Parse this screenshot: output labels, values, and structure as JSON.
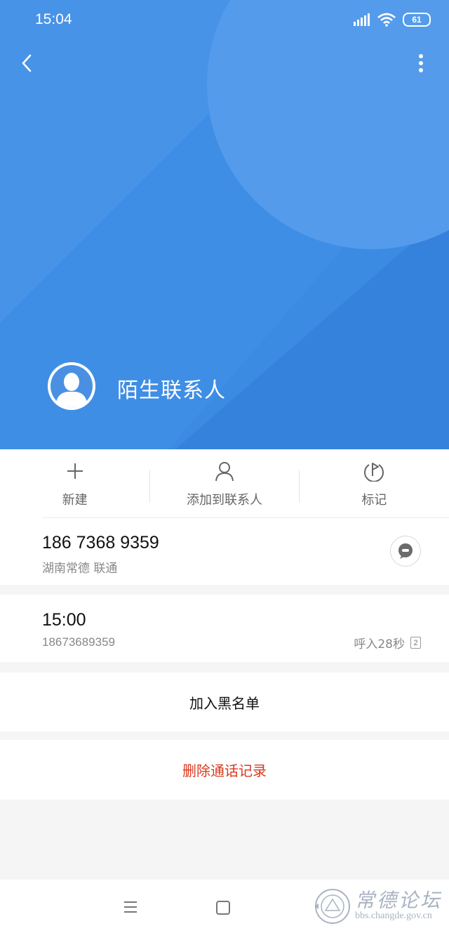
{
  "status_bar": {
    "time": "15:04",
    "battery": "61"
  },
  "contact": {
    "name": "陌生联系人"
  },
  "actions": [
    {
      "label": "新建",
      "icon": "plus-icon"
    },
    {
      "label": "添加到联系人",
      "icon": "person-icon"
    },
    {
      "label": "标记",
      "icon": "flag-icon"
    }
  ],
  "phone": {
    "number": "186 7368 9359",
    "location": "湖南常德 联通"
  },
  "call_record": {
    "time": "15:00",
    "number": "18673689359",
    "info": "呼入28秒",
    "sim": "2"
  },
  "blacklist_label": "加入黑名单",
  "delete_label": "删除通话记录",
  "watermark": {
    "title": "常德论坛",
    "url": "bbs.changde.gov.cn"
  },
  "colors": {
    "header": "#3b8be3",
    "delete": "#d9381e"
  }
}
